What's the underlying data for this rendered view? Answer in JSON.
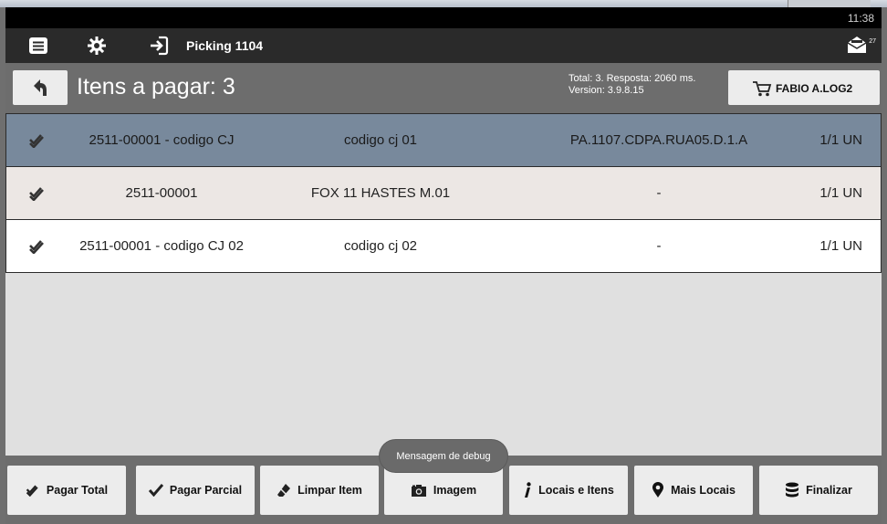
{
  "status_bar": {
    "time": "11:38"
  },
  "action_bar": {
    "title": "Picking 1104",
    "message_count": "27"
  },
  "subheader": {
    "title": "Itens a pagar: 3",
    "info_line1": "Total: 3. Resposta: 2060 ms.",
    "info_line2": "Version: 3.9.8.15",
    "user_label": "FABIO A.LOG2"
  },
  "items": [
    {
      "code": "2511-00001 - codigo CJ",
      "description": "codigo cj 01",
      "location": "PA.1107.CDPA.RUA05.D.1.A",
      "quantity": "1/1 UN"
    },
    {
      "code": "2511-00001",
      "description": "FOX 11 HASTES M.01",
      "location": "-",
      "quantity": "1/1 UN"
    },
    {
      "code": "2511-00001 - codigo CJ 02",
      "description": "codigo cj 02",
      "location": "-",
      "quantity": "1/1 UN"
    }
  ],
  "toast": {
    "text": "Mensagem de debug"
  },
  "toolbar": {
    "pagar_total": "Pagar Total",
    "pagar_parcial": "Pagar Parcial",
    "limpar_item": "Limpar Item",
    "imagem": "Imagem",
    "locais_itens": "Locais e Itens",
    "mais_locais": "Mais Locais",
    "finalizar": "Finalizar"
  },
  "colors": {
    "selected_row": "#78899c",
    "alt_row": "#ece7e4",
    "bar_dark": "#2a2a2a",
    "panel_gray": "#6d6d6d",
    "button_light": "#ececec"
  }
}
